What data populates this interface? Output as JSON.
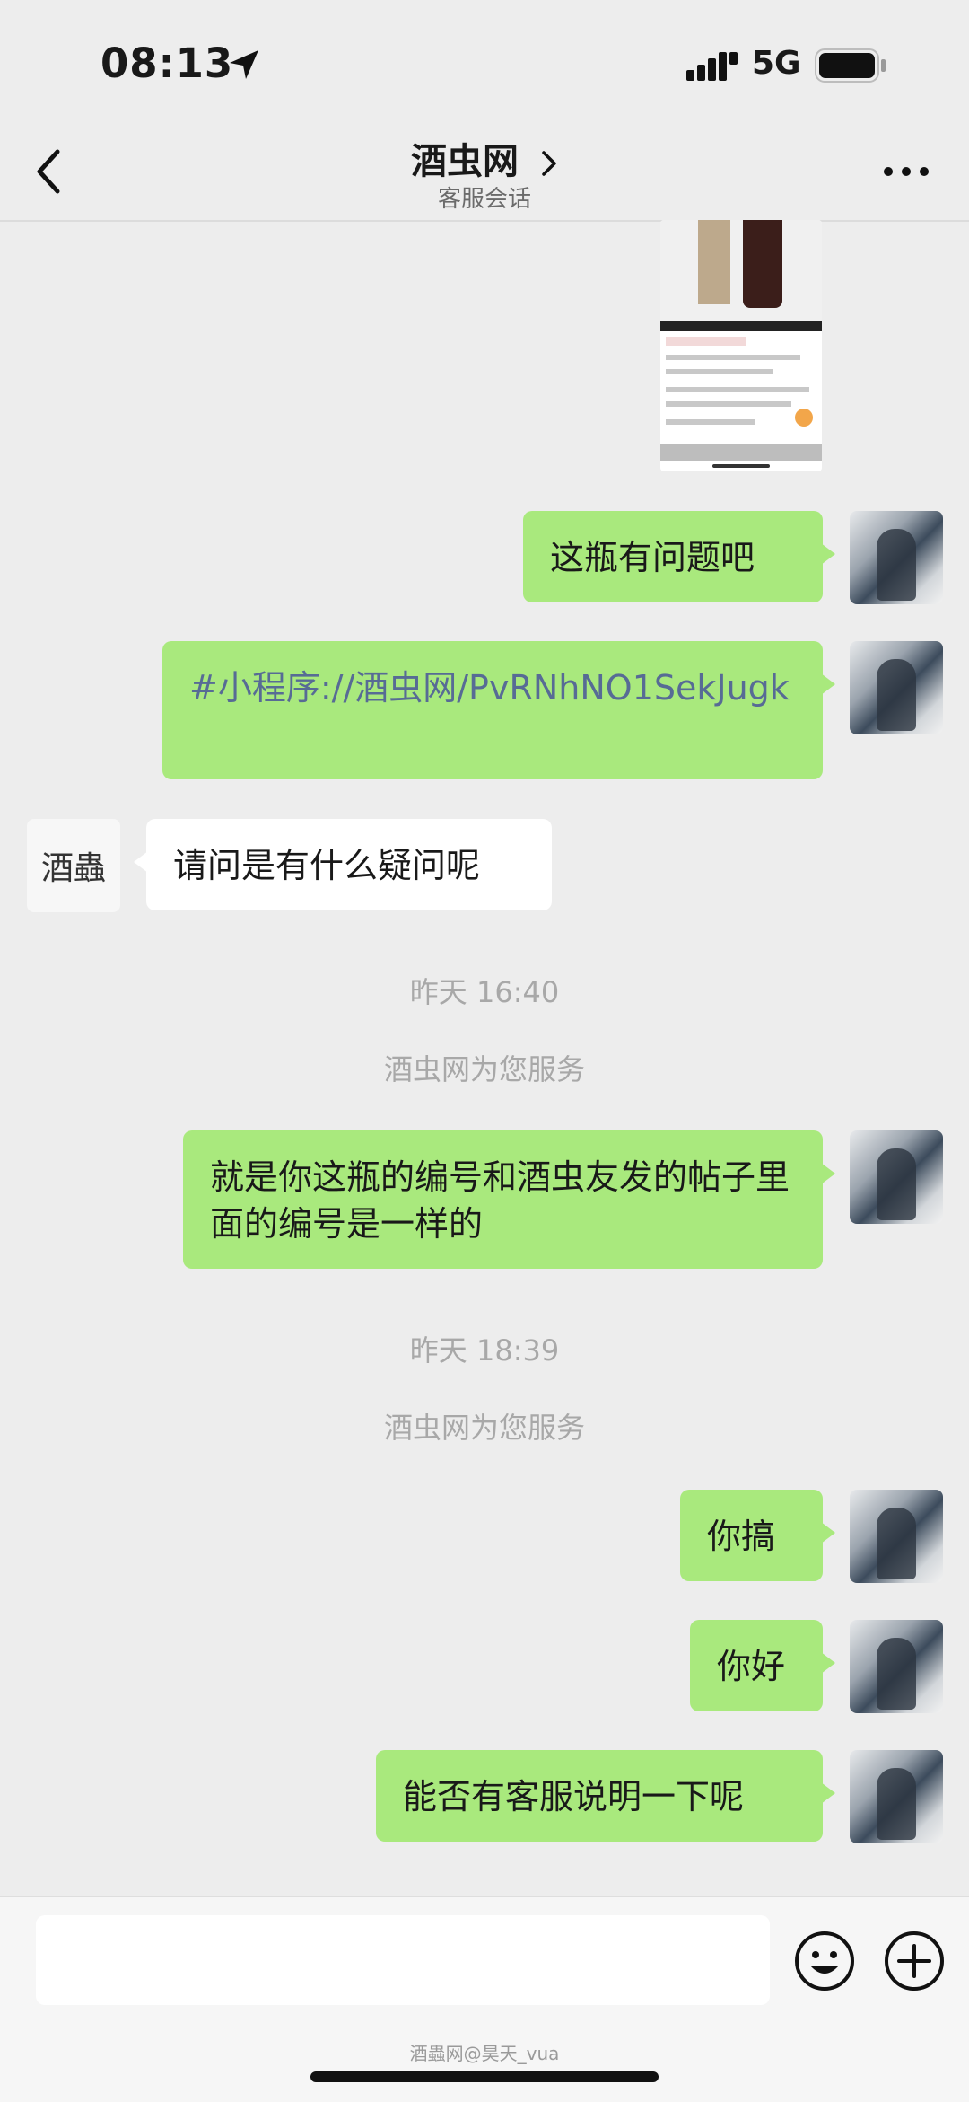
{
  "status": {
    "time": "08:13",
    "network": "5G"
  },
  "nav": {
    "title": "酒虫网",
    "subtitle": "客服会话"
  },
  "messages": {
    "m1": "这瓶有问题吧",
    "m2": "#小程序://酒虫网/PvRNhNO1SekJugk",
    "m3": "请问是有什么疑问呢",
    "t1": "昨天 16:40",
    "n1": "酒虫网为您服务",
    "m4": "就是你这瓶的编号和酒虫友发的帖子里面的编号是一样的",
    "t2": "昨天 18:39",
    "n2": "酒虫网为您服务",
    "m5": "你搞",
    "m6": "你好",
    "m7": "能否有客服说明一下呢"
  },
  "shop_avatar_text": "酒蟲",
  "input": {
    "value": ""
  },
  "watermark": "酒蟲网@昊天_vua",
  "colors": {
    "bg": "#ededed",
    "bubble_out": "#a9e97d",
    "bubble_in": "#ffffff",
    "link": "#576b95"
  },
  "icons": [
    "location-arrow-icon",
    "signal-icon",
    "battery-icon",
    "back-icon",
    "chevron-right-icon",
    "more-icon",
    "emoji-icon",
    "plus-icon"
  ]
}
